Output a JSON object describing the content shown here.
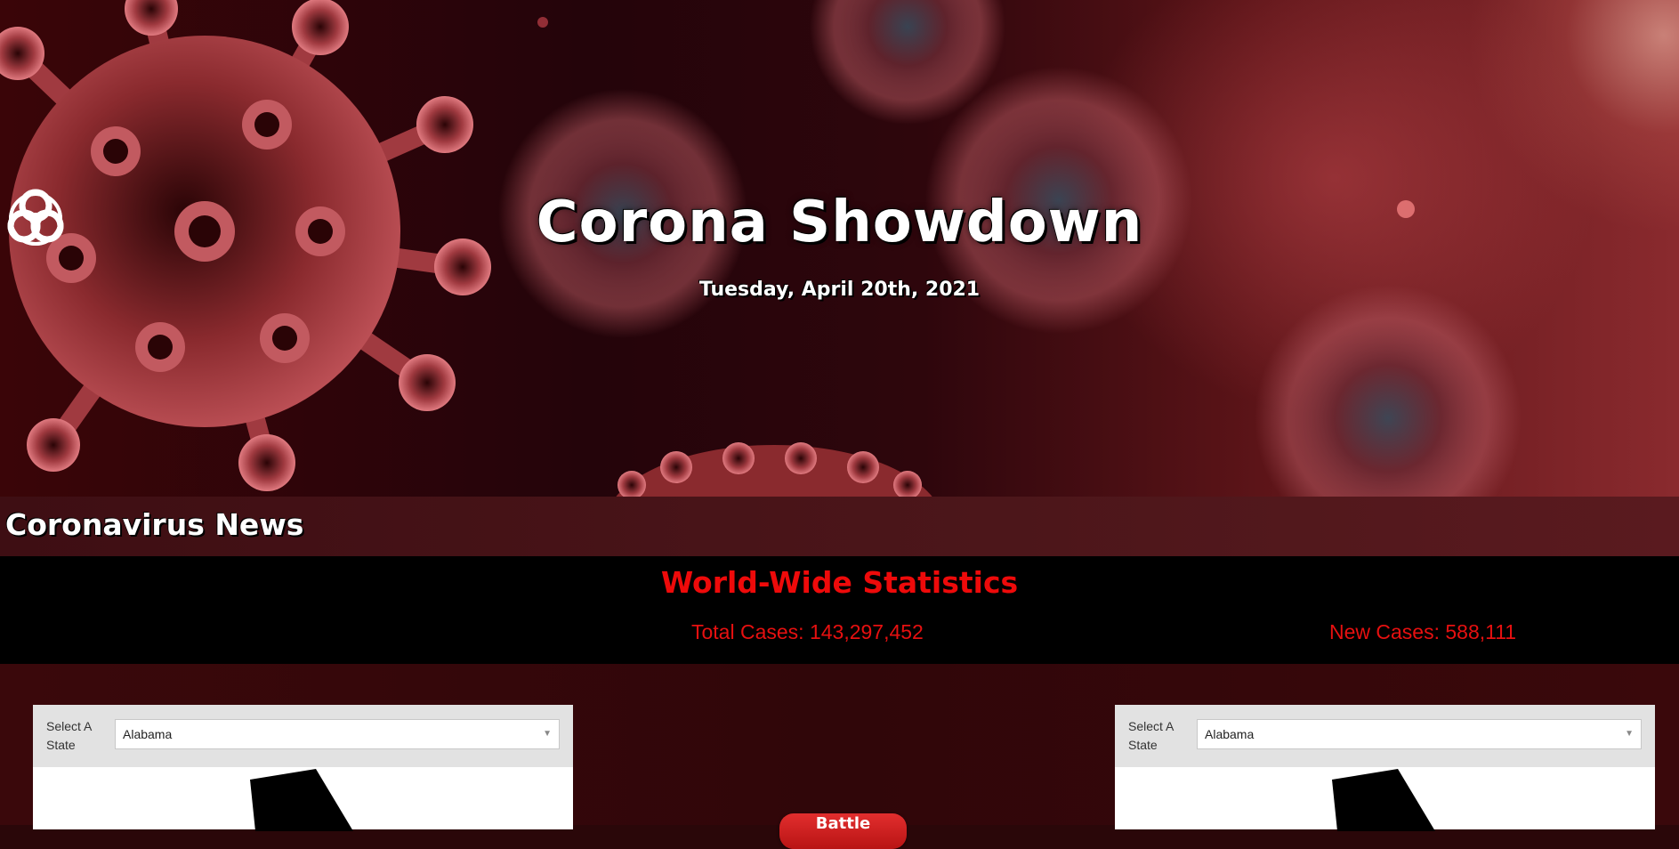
{
  "header": {
    "title": "Corona Showdown",
    "date": "Tuesday, April 20th, 2021"
  },
  "news": {
    "title": "Coronavirus News"
  },
  "stats": {
    "title": "World-Wide Statistics",
    "total_cases": "Total Cases: 143,297,452",
    "new_cases": "New Cases: 588,111"
  },
  "left_panel": {
    "select_label": "Select A State",
    "selected_state": "Alabama"
  },
  "right_panel": {
    "select_label": "Select A State",
    "selected_state": "Alabama"
  },
  "battle_button": {
    "label": "Battle"
  },
  "colors": {
    "stats_red": "#e61010",
    "header_title": "#ffffff",
    "background": "#2a0709"
  },
  "icons": {
    "title_icon": "biohazard-icon",
    "dropdown_icon": "caret-down-icon"
  }
}
